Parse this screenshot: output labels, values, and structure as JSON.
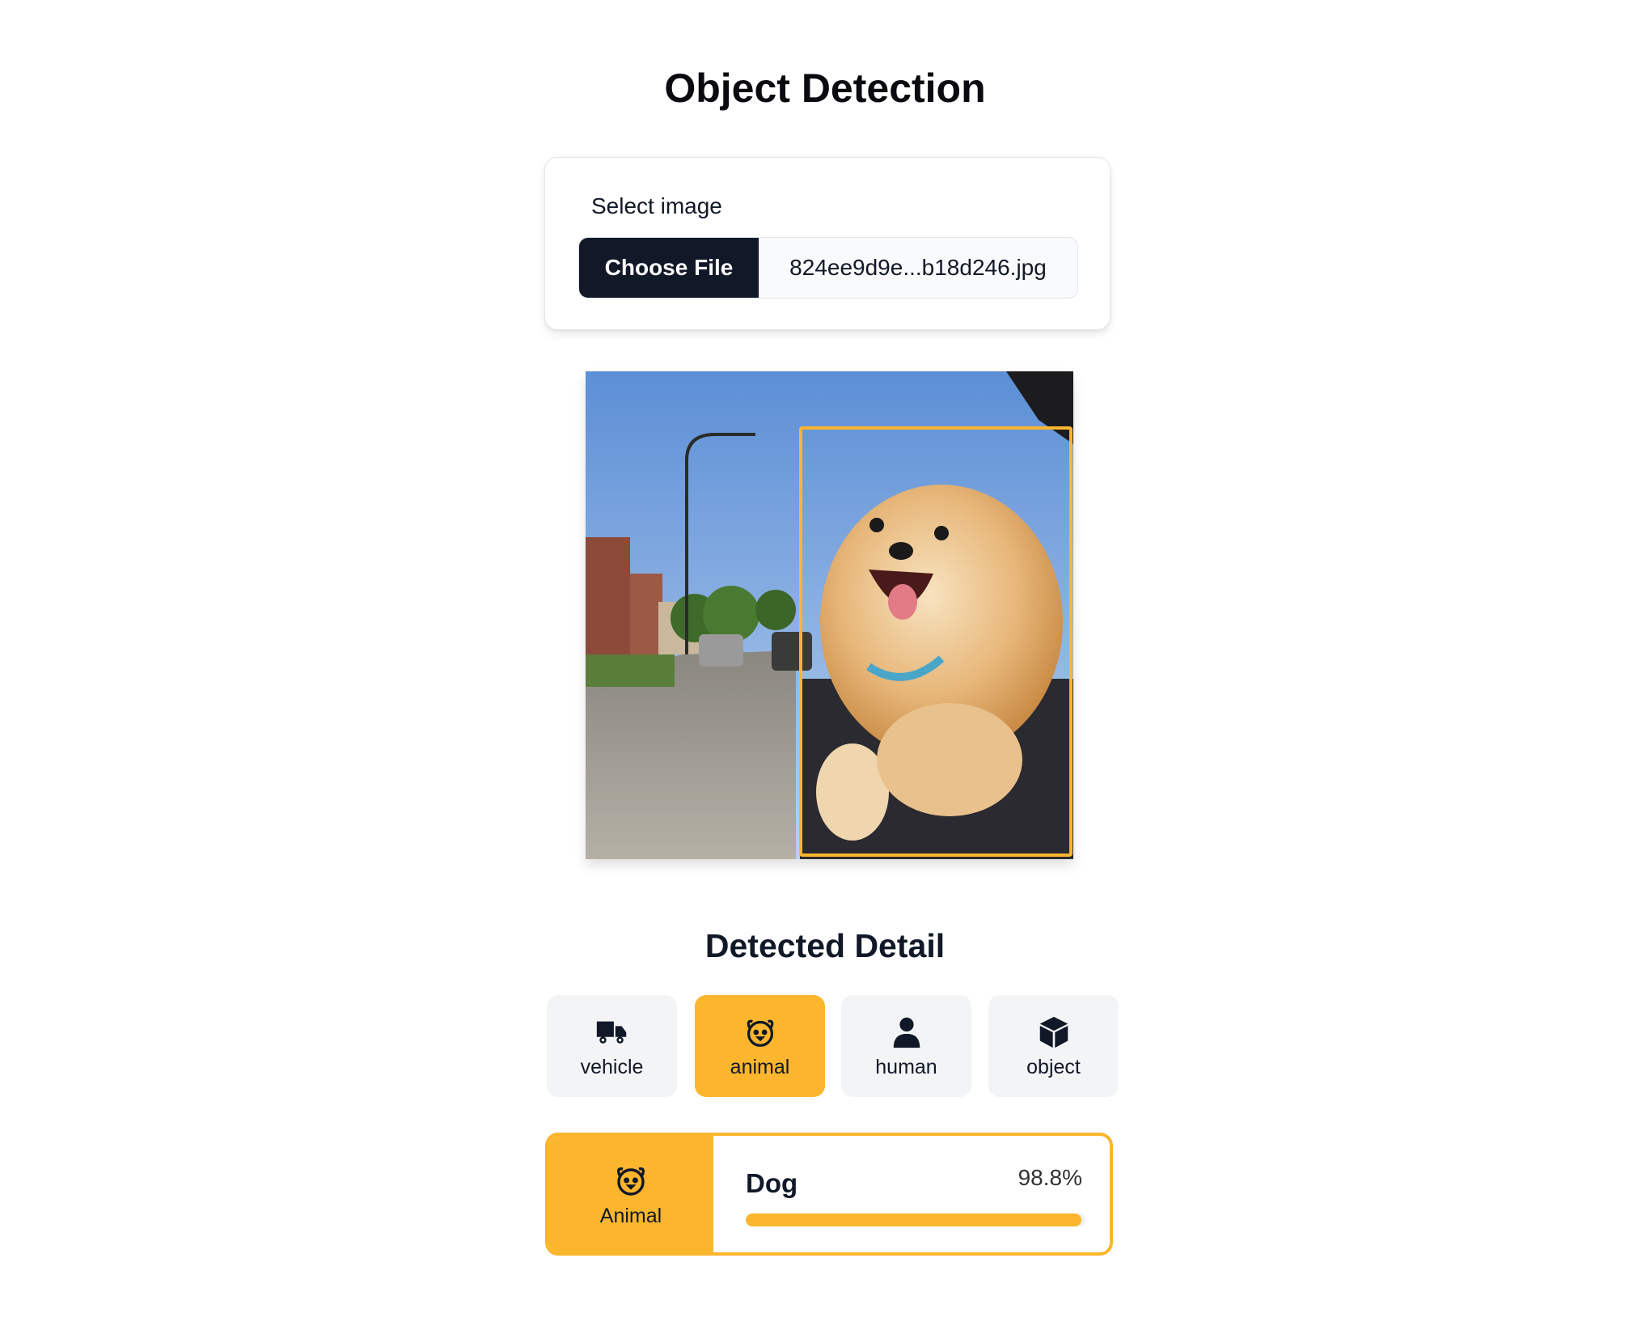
{
  "page": {
    "title": "Object Detection"
  },
  "upload": {
    "label": "Select image",
    "button_label": "Choose File",
    "file_name": "824ee9d9e...b18d246.jpg"
  },
  "image": {
    "detection_box_color": "#fbb62e",
    "subject": "dog"
  },
  "detail": {
    "title": "Detected Detail",
    "tabs": [
      {
        "label": "vehicle",
        "icon": "truck-icon",
        "active": false
      },
      {
        "label": "animal",
        "icon": "dog-icon",
        "active": true
      },
      {
        "label": "human",
        "icon": "person-icon",
        "active": false
      },
      {
        "label": "object",
        "icon": "cube-icon",
        "active": false
      }
    ]
  },
  "result": {
    "category": "Animal",
    "icon": "dog-icon",
    "name": "Dog",
    "score_text": "98.8%",
    "score": 0.988
  },
  "colors": {
    "accent": "#fbb62e",
    "dark": "#111827",
    "tab_bg": "#f3f4f6"
  }
}
